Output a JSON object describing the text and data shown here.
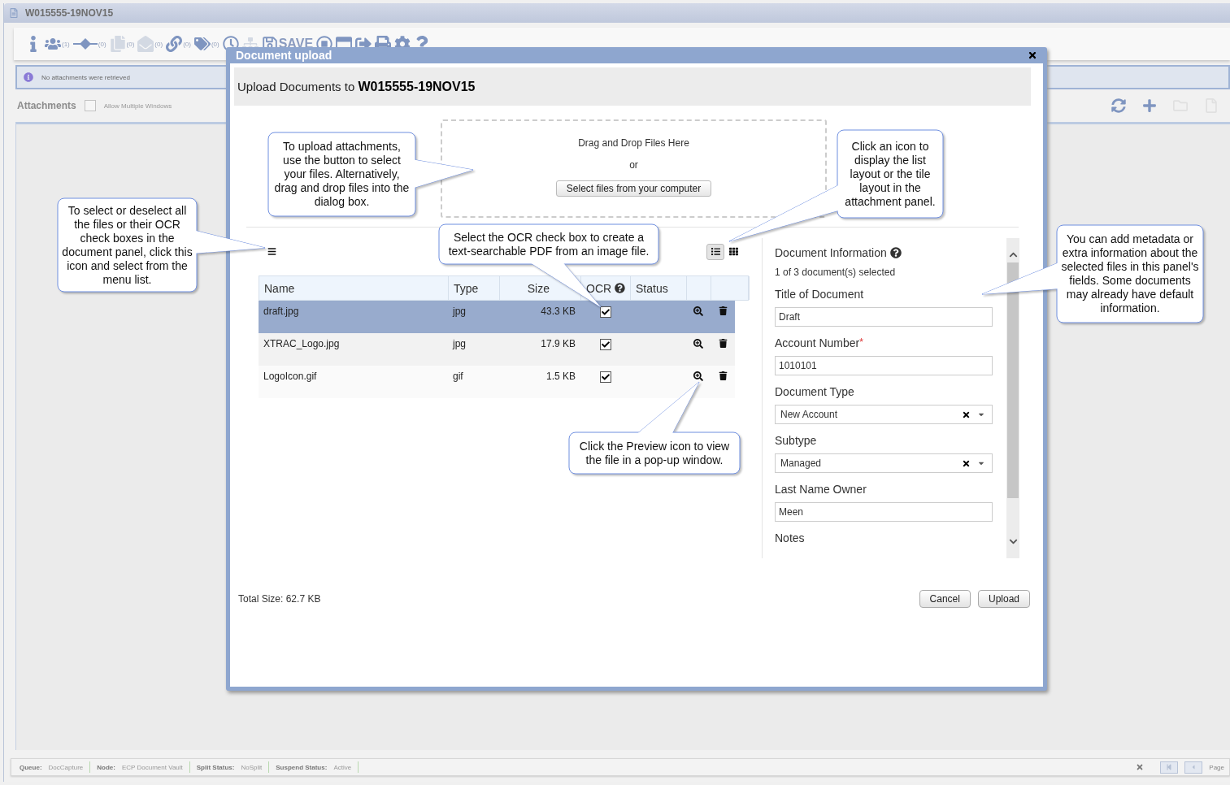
{
  "window": {
    "title": "W015555-19NOV15"
  },
  "toolbar": [
    {
      "kind": "info",
      "disabled": false
    },
    {
      "kind": "people",
      "count": "(1)",
      "disabled": false
    },
    {
      "kind": "diamond",
      "count": "(0)",
      "disabled": false
    },
    {
      "kind": "copy",
      "count": "(0)",
      "disabled": true
    },
    {
      "kind": "mail",
      "count": "(0)",
      "disabled": true
    },
    {
      "kind": "link",
      "count": "(0)",
      "disabled": false
    },
    {
      "kind": "tags",
      "count": "(0)",
      "disabled": false
    },
    {
      "kind": "clock",
      "disabled": false
    },
    {
      "kind": "network",
      "disabled": true
    },
    {
      "kind": "save",
      "label": "SAVE",
      "disabled": false
    },
    {
      "kind": "record",
      "disabled": false
    },
    {
      "kind": "window",
      "disabled": false
    },
    {
      "kind": "export",
      "disabled": false
    },
    {
      "kind": "print",
      "disabled": false
    },
    {
      "kind": "gear",
      "disabled": false
    },
    {
      "kind": "help",
      "disabled": false
    }
  ],
  "info_bar": {
    "message": "No attachments were retrieved"
  },
  "attachments": {
    "title": "Attachments",
    "allow_multiple": {
      "label": "Allow Multiple Windows",
      "checked": false
    },
    "actions": [
      {
        "kind": "refresh",
        "disabled": false
      },
      {
        "kind": "add",
        "disabled": false
      },
      {
        "kind": "folder",
        "disabled": true
      },
      {
        "kind": "document",
        "disabled": true
      }
    ]
  },
  "status_bar": {
    "items": [
      {
        "label": "Queue:",
        "value": "DocCapture"
      },
      {
        "label": "Node:",
        "value": "ECP Document Vault"
      },
      {
        "label": "Split Status:",
        "value": "NoSplit"
      },
      {
        "label": "Suspend Status:",
        "value": "Active"
      }
    ],
    "pager": [
      {
        "kind": "first",
        "disabled": true
      },
      {
        "kind": "prev",
        "disabled": true
      }
    ],
    "page_label": "Page"
  },
  "dialog": {
    "title": "Document upload",
    "heading": "Upload Documents to **W015555-19NOV15**",
    "dropzone": {
      "prompt": "Drag and Drop Files Here",
      "or": "or",
      "button": "Select files from your computer"
    },
    "views": [
      {
        "kind": "list",
        "selected": true
      },
      {
        "kind": "tile",
        "selected": false
      }
    ],
    "columns": [
      {
        "label": "Name",
        "help": false
      },
      {
        "label": "Type",
        "help": false
      },
      {
        "label": "Size",
        "help": false
      },
      {
        "label": "OCR",
        "help": true
      },
      {
        "label": "Status",
        "help": false
      }
    ],
    "files": [
      {
        "name": "draft.jpg",
        "type": "jpg",
        "size": "43.3 KB",
        "ocr": true,
        "selected": true
      },
      {
        "name": "XTRAC_Logo.jpg",
        "type": "jpg",
        "size": "17.9 KB",
        "ocr": true,
        "selected": false
      },
      {
        "name": "LogoIcon.gif",
        "type": "gif",
        "size": "1.5 KB",
        "ocr": true,
        "selected": false
      }
    ],
    "info": {
      "title": "Document Information",
      "count": "1 of 3 document(s) selected",
      "fields": [
        {
          "kind": "text",
          "label": "Title of Document",
          "value": "Draft"
        },
        {
          "kind": "text",
          "label": "Account Number",
          "required_mark": "*",
          "value": "1010101"
        },
        {
          "kind": "select",
          "label": "Document Type",
          "value": "New Account"
        },
        {
          "kind": "select",
          "label": "Subtype",
          "value": "Managed"
        },
        {
          "kind": "text",
          "label": "Last Name Owner",
          "value": "Meen"
        },
        {
          "kind": "label",
          "label": "Notes"
        }
      ]
    },
    "total": "Total Size: 62.7 KB",
    "buttons": [
      "Cancel",
      "Upload"
    ]
  },
  "callouts": [
    {
      "text": "To upload attachments, use the button to select your files. Alternatively, drag and drop files into the dialog box."
    },
    {
      "text": "To select or deselect all the files or their OCR check boxes in the document panel, click this icon and select from the menu list."
    },
    {
      "text": "Select the OCR check box to create a text-searchable PDF from an image file."
    },
    {
      "text": "Click an icon to display the list layout or the tile layout in the attachment panel."
    },
    {
      "text": "Click the Preview icon to view the file in a pop-up window."
    },
    {
      "text": "You can add metadata or extra information about the selected files in this panel's fields. Some documents may already have default information."
    }
  ]
}
